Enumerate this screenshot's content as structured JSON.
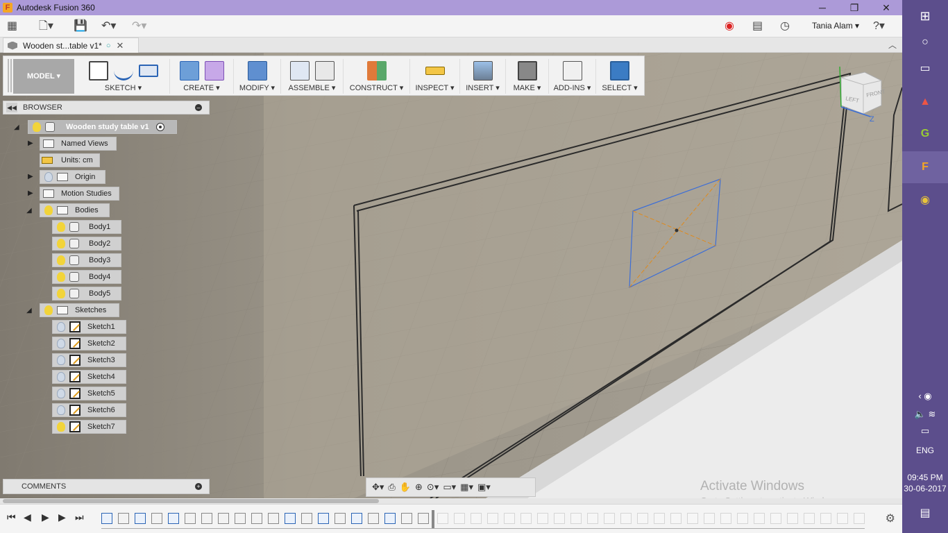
{
  "window": {
    "title": "Autodesk Fusion 360",
    "app_icon": "F"
  },
  "app_toolbar": {
    "user_name": "Tania Alam"
  },
  "document_tab": {
    "name": "Wooden st...table v1*"
  },
  "ribbon": {
    "workspace": "MODEL",
    "groups": [
      {
        "label": "SKETCH"
      },
      {
        "label": "CREATE"
      },
      {
        "label": "MODIFY"
      },
      {
        "label": "ASSEMBLE"
      },
      {
        "label": "CONSTRUCT"
      },
      {
        "label": "INSPECT"
      },
      {
        "label": "INSERT"
      },
      {
        "label": "MAKE"
      },
      {
        "label": "ADD-INS"
      },
      {
        "label": "SELECT"
      }
    ],
    "dropdown_glyph": "▾"
  },
  "browser": {
    "title": "BROWSER",
    "root": "Wooden study table v1",
    "named_views": "Named Views",
    "units": "Units: cm",
    "origin": "Origin",
    "motion_studies": "Motion Studies",
    "bodies_folder": "Bodies",
    "bodies": [
      "Body1",
      "Body2",
      "Body3",
      "Body4",
      "Body5"
    ],
    "sketches_folder": "Sketches",
    "sketches": [
      "Sketch1",
      "Sketch2",
      "Sketch3",
      "Sketch4",
      "Sketch5",
      "Sketch6",
      "Sketch7"
    ]
  },
  "comments": {
    "title": "COMMENTS"
  },
  "viewcube": {
    "left_label": "LEFT",
    "front_label": "FRONT",
    "axis_z": "Z"
  },
  "watermark": {
    "line1": "Activate Windows",
    "line2": "Go to Settings to activate Windows."
  },
  "taskbar": {
    "time": "09:45 PM",
    "date": "30-06-2017",
    "language": "ENG"
  }
}
